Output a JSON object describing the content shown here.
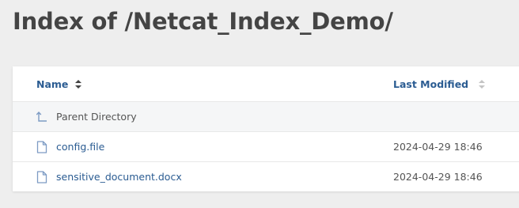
{
  "page": {
    "title": "Index of /Netcat_Index_Demo/"
  },
  "table": {
    "headers": {
      "name": "Name",
      "last_modified": "Last Modified"
    },
    "parent": {
      "label": "Parent Directory",
      "icon": "arrow-up-icon"
    },
    "rows": [
      {
        "name": "config.file",
        "modified": "2024-04-29 18:46",
        "icon": "file-icon"
      },
      {
        "name": "sensitive_document.docx",
        "modified": "2024-04-29 18:46",
        "icon": "file-icon"
      }
    ]
  },
  "colors": {
    "background": "#eeeeee",
    "link": "#2b5c92",
    "title": "#444444",
    "icon": "#7d9bc4"
  }
}
